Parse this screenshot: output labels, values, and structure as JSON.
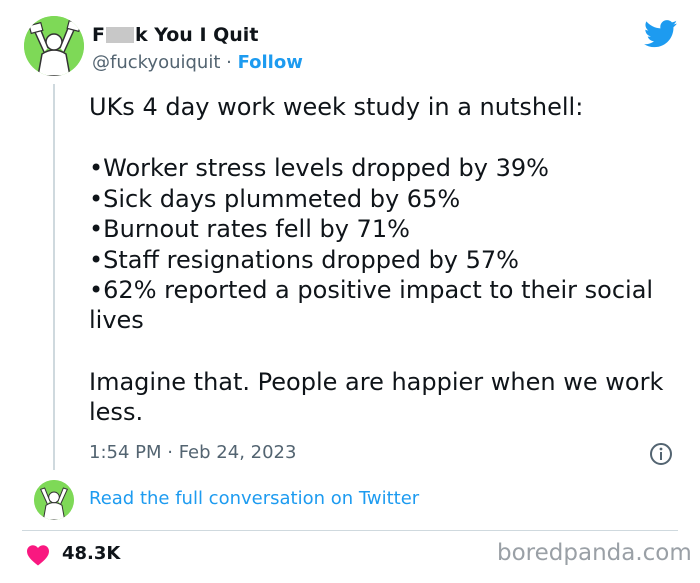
{
  "author": {
    "name_prefix": "F",
    "name_suffix": "k You I Quit",
    "handle": "@fuckyouiquit",
    "separator": " · ",
    "follow_label": "Follow"
  },
  "tweet": {
    "intro": "UKs 4 day work week study in a nutshell:",
    "bullets": [
      "•Worker stress levels dropped by 39%",
      "•Sick days plummeted by 65%",
      "•Burnout rates fell by 71%",
      "•Staff resignations dropped by 57%",
      "•62% reported a positive impact to their social lives"
    ],
    "closing": "Imagine that. People are happier when we work less.",
    "timestamp": "1:54 PM · Feb 24, 2023"
  },
  "conversation_link": "Read the full conversation on Twitter",
  "likes": "48.3K",
  "watermark": "boredpanda.com",
  "colors": {
    "brand_blue": "#1d9bf0",
    "heart_pink": "#f91880",
    "avatar_green": "#7ed957",
    "text": "#0f1419",
    "muted": "#536471"
  },
  "icons": {
    "logo": "twitter-bird-icon",
    "info": "info-icon",
    "like": "heart-icon"
  }
}
